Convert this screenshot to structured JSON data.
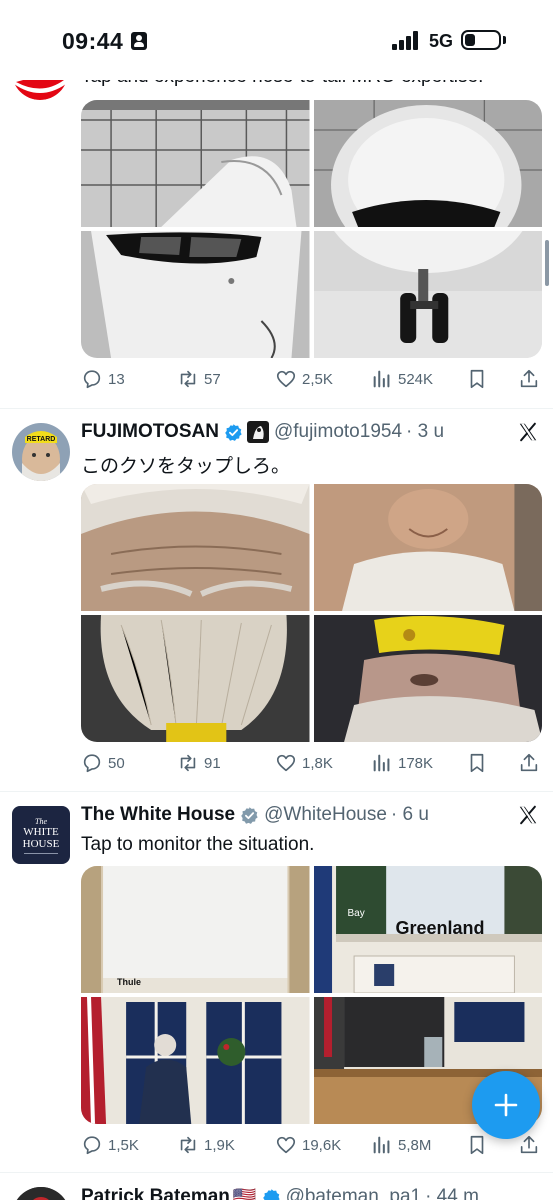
{
  "status_bar": {
    "time": "09:44",
    "network": "5G"
  },
  "tweets": [
    {
      "text": "Tap and experience nose-to-tail MRO expertise!",
      "actions": {
        "replies": "13",
        "reposts": "57",
        "likes": "2,5K",
        "views": "524K"
      }
    },
    {
      "name": "FUJIMOTOSAN",
      "handle": "@fujimoto1954",
      "time": "· 3 u",
      "text": "このクソをタップしろ。",
      "avatar_badge": "RETARD",
      "actions": {
        "replies": "50",
        "reposts": "91",
        "likes": "1,8K",
        "views": "178K"
      }
    },
    {
      "name": "The White House",
      "handle": "@WhiteHouse",
      "time": "· 6 u",
      "text": "Tap to monitor the situation.",
      "avatar": {
        "the": "The",
        "line1": "WHITE",
        "line2": "HOUSE"
      },
      "media_labels": {
        "greenland": "Greenland",
        "bay": "Bay",
        "thule": "Thule"
      },
      "actions": {
        "replies": "1,5K",
        "reposts": "1,9K",
        "likes": "19,6K",
        "views": "5,8M"
      }
    },
    {
      "name": "Patrick Bateman",
      "flag": "🇺🇸",
      "handle": "@bateman_pa1",
      "time": "· 44 m"
    }
  ],
  "colors": {
    "accent": "#1d9bf0",
    "text": "#0f1419",
    "secondary": "#536471",
    "divider": "#eff3f4"
  }
}
